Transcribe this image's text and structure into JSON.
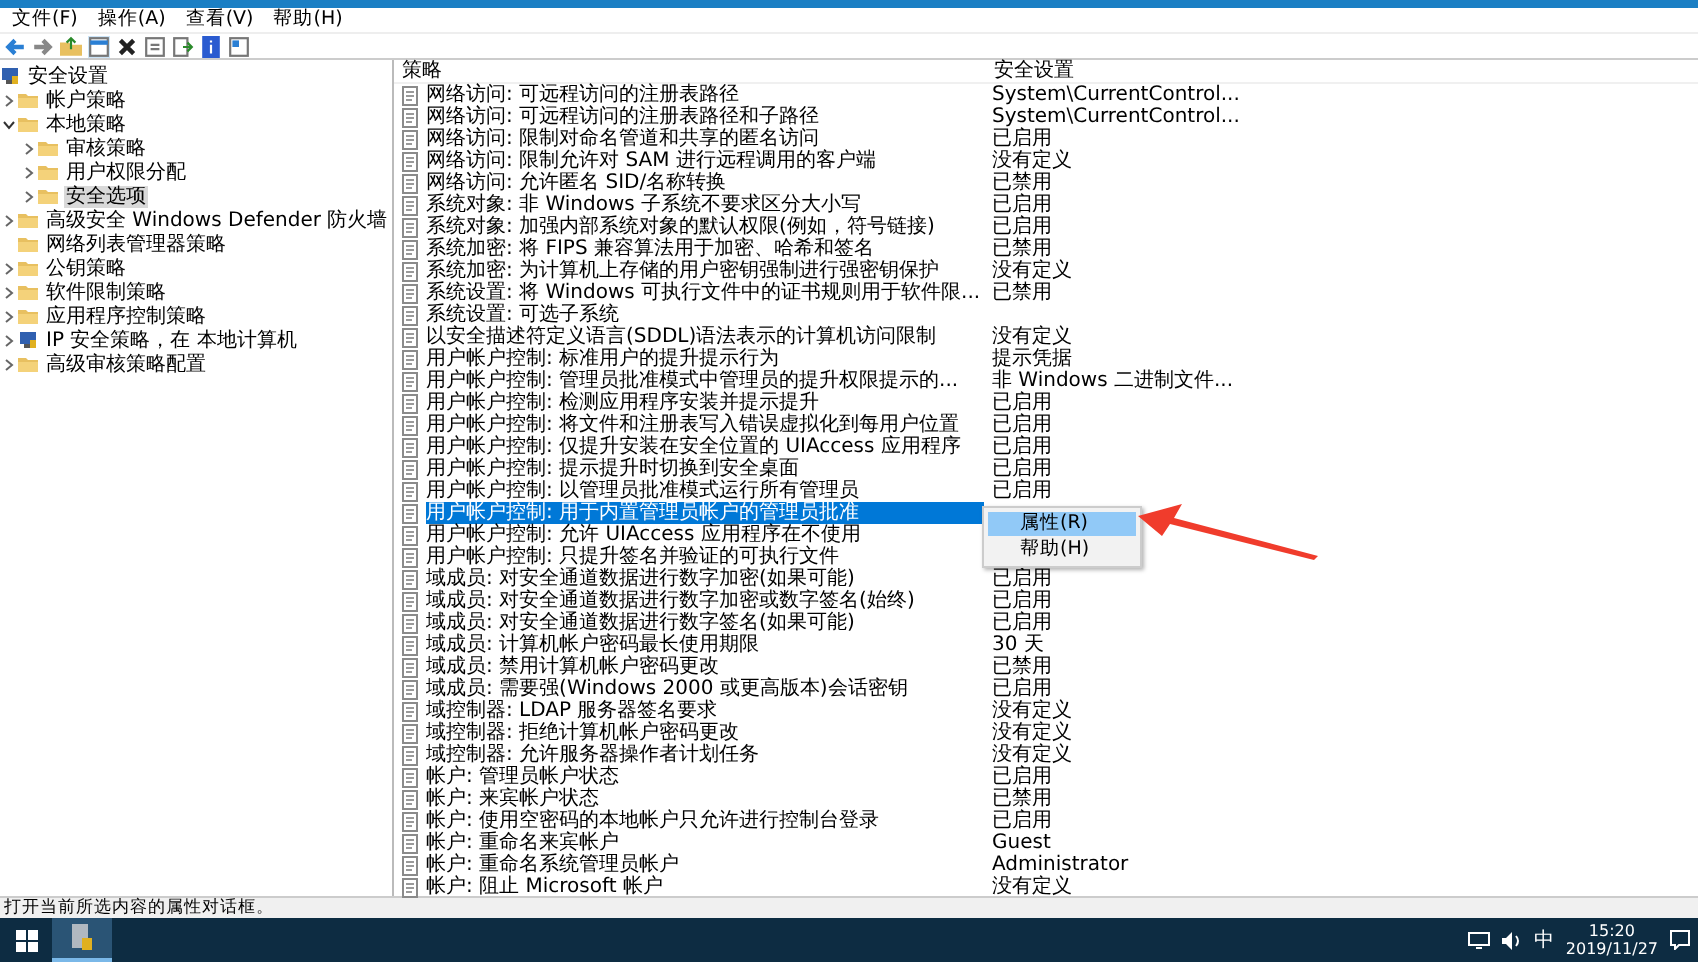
{
  "menu": [
    "文件(F)",
    "操作(A)",
    "查看(V)",
    "帮助(H)"
  ],
  "tree": {
    "label": "安全设置",
    "selected": false,
    "children": [
      {
        "label": "帐户策略",
        "expanded": false,
        "selected": false
      },
      {
        "label": "本地策略",
        "expanded": true,
        "selected": false,
        "children": [
          {
            "label": "审核策略",
            "expanded": false,
            "selected": false
          },
          {
            "label": "用户权限分配",
            "expanded": false,
            "selected": false
          },
          {
            "label": "安全选项",
            "expanded": false,
            "selected": true
          }
        ]
      },
      {
        "label": "高级安全 Windows Defender 防火墙",
        "expanded": false,
        "selected": false
      },
      {
        "label": "网络列表管理器策略",
        "selected": false
      },
      {
        "label": "公钥策略",
        "expanded": false,
        "selected": false
      },
      {
        "label": "软件限制策略",
        "expanded": false,
        "selected": false
      },
      {
        "label": "应用程序控制策略",
        "expanded": false,
        "selected": false
      },
      {
        "label": "IP 安全策略，在 本地计算机",
        "expanded": false,
        "selected": false,
        "kind": "ipsec"
      },
      {
        "label": "高级审核策略配置",
        "expanded": false,
        "selected": false
      }
    ]
  },
  "table": {
    "columns": [
      "策略",
      "安全设置"
    ],
    "rows": [
      {
        "policy": "网络访问: 可远程访问的注册表路径",
        "setting": "System\\CurrentControl...",
        "selected": false
      },
      {
        "policy": "网络访问: 可远程访问的注册表路径和子路径",
        "setting": "System\\CurrentControl...",
        "selected": false
      },
      {
        "policy": "网络访问: 限制对命名管道和共享的匿名访问",
        "setting": "已启用",
        "selected": false
      },
      {
        "policy": "网络访问: 限制允许对 SAM 进行远程调用的客户端",
        "setting": "没有定义",
        "selected": false
      },
      {
        "policy": "网络访问: 允许匿名 SID/名称转换",
        "setting": "已禁用",
        "selected": false
      },
      {
        "policy": "系统对象: 非 Windows 子系统不要求区分大小写",
        "setting": "已启用",
        "selected": false
      },
      {
        "policy": "系统对象: 加强内部系统对象的默认权限(例如，符号链接)",
        "setting": "已启用",
        "selected": false
      },
      {
        "policy": "系统加密: 将 FIPS 兼容算法用于加密、哈希和签名",
        "setting": "已禁用",
        "selected": false
      },
      {
        "policy": "系统加密: 为计算机上存储的用户密钥强制进行强密钥保护",
        "setting": "没有定义",
        "selected": false
      },
      {
        "policy": "系统设置: 将 Windows 可执行文件中的证书规则用于软件限...",
        "setting": "已禁用",
        "selected": false
      },
      {
        "policy": "系统设置: 可选子系统",
        "selected": false
      },
      {
        "policy": "以安全描述符定义语言(SDDL)语法表示的计算机访问限制",
        "setting": "没有定义",
        "selected": false
      },
      {
        "policy": "用户帐户控制: 标准用户的提升提示行为",
        "setting": "提示凭据",
        "selected": false
      },
      {
        "policy": "用户帐户控制: 管理员批准模式中管理员的提升权限提示的...",
        "setting": "非 Windows 二进制文件...",
        "selected": false
      },
      {
        "policy": "用户帐户控制: 检测应用程序安装并提示提升",
        "setting": "已启用",
        "selected": false
      },
      {
        "policy": "用户帐户控制: 将文件和注册表写入错误虚拟化到每用户位置",
        "setting": "已启用",
        "selected": false
      },
      {
        "policy": "用户帐户控制: 仅提升安装在安全位置的 UIAccess 应用程序",
        "setting": "已启用",
        "selected": false
      },
      {
        "policy": "用户帐户控制: 提示提升时切换到安全桌面",
        "setting": "已启用",
        "selected": false
      },
      {
        "policy": "用户帐户控制: 以管理员批准模式运行所有管理员",
        "setting": "已启用",
        "selected": false
      },
      {
        "policy": "用户帐户控制: 用于内置管理员帐户的管理员批准",
        "selected": true
      },
      {
        "policy": "用户帐户控制: 允许 UIAccess 应用程序在不使用",
        "selected": false
      },
      {
        "policy": "用户帐户控制: 只提升签名并验证的可执行文件",
        "selected": false
      },
      {
        "policy": "域成员: 对安全通道数据进行数字加密(如果可能)",
        "setting": "已启用",
        "selected": false
      },
      {
        "policy": "域成员: 对安全通道数据进行数字加密或数字签名(始终)",
        "setting": "已启用",
        "selected": false
      },
      {
        "policy": "域成员: 对安全通道数据进行数字签名(如果可能)",
        "setting": "已启用",
        "selected": false
      },
      {
        "policy": "域成员: 计算机帐户密码最长使用期限",
        "setting": "30 天",
        "selected": false
      },
      {
        "policy": "域成员: 禁用计算机帐户密码更改",
        "setting": "已禁用",
        "selected": false
      },
      {
        "policy": "域成员: 需要强(Windows 2000 或更高版本)会话密钥",
        "setting": "已启用",
        "selected": false
      },
      {
        "policy": "域控制器: LDAP 服务器签名要求",
        "setting": "没有定义",
        "selected": false
      },
      {
        "policy": "域控制器: 拒绝计算机帐户密码更改",
        "setting": "没有定义",
        "selected": false
      },
      {
        "policy": "域控制器: 允许服务器操作者计划任务",
        "setting": "没有定义",
        "selected": false
      },
      {
        "policy": "帐户: 管理员帐户状态",
        "setting": "已启用",
        "selected": false
      },
      {
        "policy": "帐户: 来宾帐户状态",
        "setting": "已禁用",
        "selected": false
      },
      {
        "policy": "帐户: 使用空密码的本地帐户只允许进行控制台登录",
        "setting": "已启用",
        "selected": false
      },
      {
        "policy": "帐户: 重命名来宾帐户",
        "setting": "Guest",
        "selected": false
      },
      {
        "policy": "帐户: 重命名系统管理员帐户",
        "setting": "Administrator",
        "selected": false
      },
      {
        "policy": "帐户: 阻止 Microsoft 帐户",
        "setting": "没有定义",
        "selected": false
      }
    ]
  },
  "context_menu": [
    {
      "label": "属性(R)",
      "selected": true
    },
    {
      "label": "帮助(H)",
      "selected": false
    }
  ],
  "status_bar": "打开当前所选内容的属性对话框。",
  "taskbar": {
    "ime": "中",
    "time": "15:20",
    "date": "2019/11/27"
  }
}
